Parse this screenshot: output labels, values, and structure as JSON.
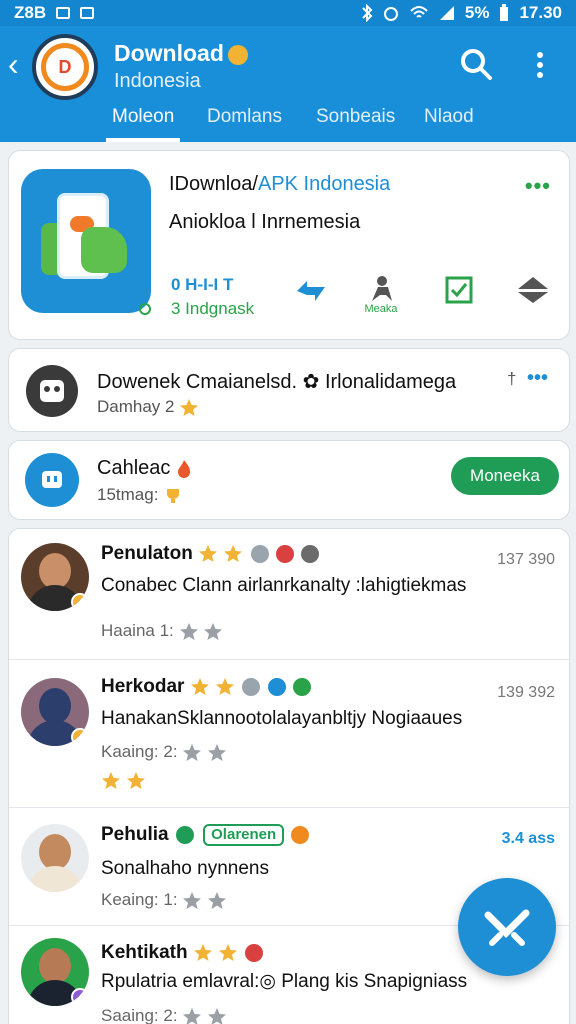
{
  "status_bar": {
    "left_text": "Z8B",
    "battery": "5%",
    "time": "17.30"
  },
  "app_bar": {
    "title": "Download",
    "subtitle": "Indonesia",
    "tabs": [
      {
        "label": "Moleon",
        "active": true
      },
      {
        "label": "Domlans",
        "active": false
      },
      {
        "label": "Sonbeais",
        "active": false
      },
      {
        "label": "Nlaod",
        "active": false
      }
    ]
  },
  "hero": {
    "title_prefix": "IDownloa/",
    "title_accent": "APK Indonesia",
    "subtitle": "Aniokloa l Inrnemesia",
    "stat_line1": "0 H-I-I T",
    "stat_line2": "3 Indgnask",
    "action_label": "Meaka"
  },
  "row1": {
    "title": "Dowenek Cmaianelsd. ✿ Irlonalidamega",
    "sub": "Damhay 2",
    "side": "†"
  },
  "row2": {
    "title": "Cahleac",
    "sub": "15tmag:",
    "button_label": "Moneeka"
  },
  "reviews": [
    {
      "name": "Penulaton",
      "text": "Conabec Clann airlanrkanalty :lahigtiekmas",
      "meta": "Haaina 1:",
      "time": "137 390"
    },
    {
      "name": "Herkodar",
      "text": "HanakanSklannootolalayanbltjy Nogiaaues",
      "meta": "Kaaing: 2:",
      "time": "139 392"
    },
    {
      "name": "Pehulia",
      "badge": "Olarenen",
      "text": "Sonalhaho nynnens",
      "meta": "Keaing: 1:",
      "time": "3.4 ass"
    },
    {
      "name": "Kehtikath",
      "text": "Rpulatria emlavral:◎ Plang kis Snapigniass",
      "meta": "Saaing: 2:",
      "time": ""
    }
  ],
  "colors": {
    "primary": "#1a8fd9",
    "accent_green": "#1f9d57",
    "star": "#f2b233"
  }
}
